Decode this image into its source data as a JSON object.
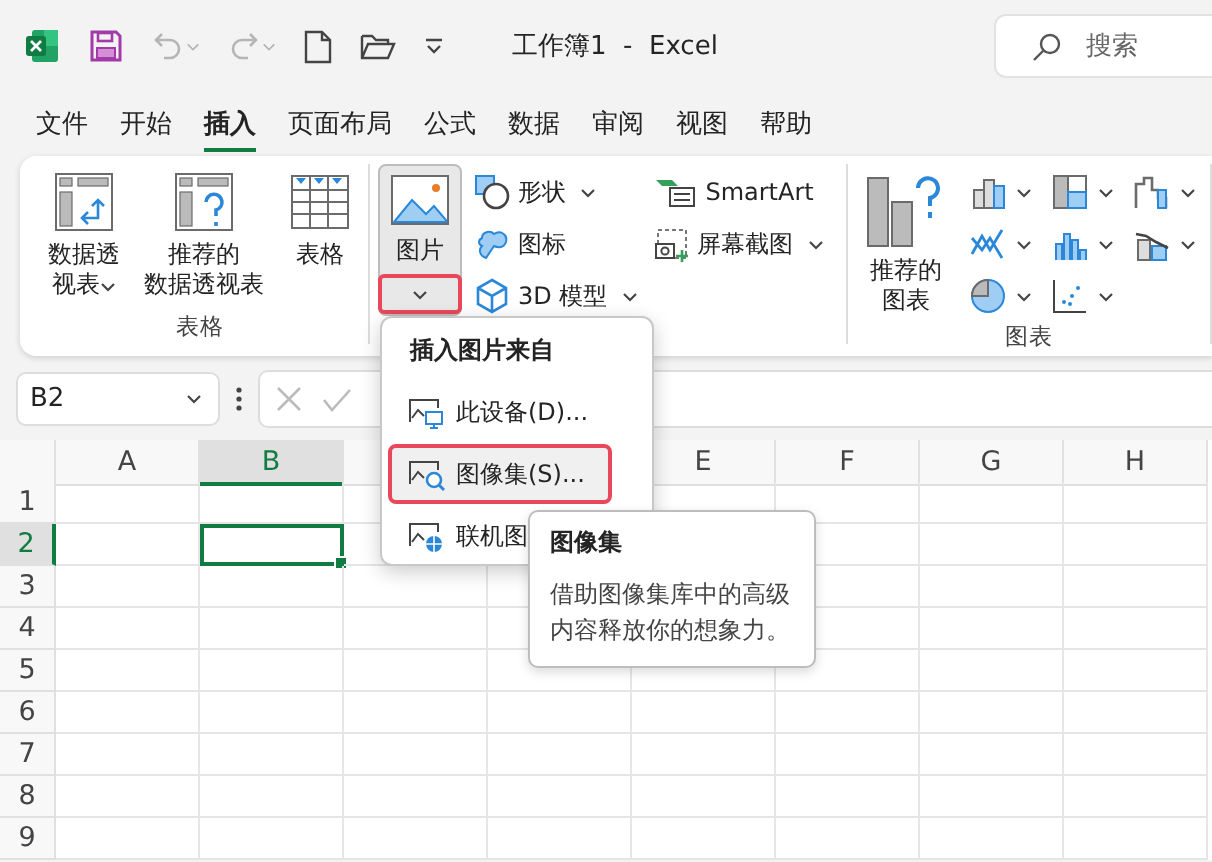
{
  "title_bar": {
    "quick_access": [
      {
        "kind": "excel"
      },
      {
        "kind": "save",
        "disabled": false
      },
      {
        "kind": "undo",
        "disabled": true
      },
      {
        "kind": "redo",
        "disabled": true
      },
      {
        "kind": "new",
        "disabled": false
      },
      {
        "kind": "open",
        "disabled": false
      },
      {
        "kind": "customize"
      }
    ],
    "title": "工作簿1  -  Excel",
    "search": {
      "placeholder": "搜索"
    }
  },
  "tabs": [
    {
      "label": "文件",
      "selected": false
    },
    {
      "label": "开始",
      "selected": false
    },
    {
      "label": "插入",
      "selected": true
    },
    {
      "label": "页面布局",
      "selected": false
    },
    {
      "label": "公式",
      "selected": false
    },
    {
      "label": "数据",
      "selected": false
    },
    {
      "label": "审阅",
      "selected": false
    },
    {
      "label": "视图",
      "selected": false
    },
    {
      "label": "帮助",
      "selected": false
    }
  ],
  "ribbon": {
    "groups": [
      {
        "label": "表格",
        "columns": [
          [
            {
              "kind": "large",
              "lines": [
                "数据透",
                "视表"
              ],
              "dropdown": true
            }
          ],
          [
            {
              "kind": "large",
              "lines": [
                "推荐的",
                "数据透视表"
              ],
              "dropdown": false
            }
          ],
          [
            {
              "kind": "large",
              "lines": [
                "表格"
              ],
              "dropdown": false
            }
          ]
        ]
      },
      {
        "columns": [
          [
            {
              "kind": "split",
              "label": "图片",
              "dropdown": true,
              "pressed": true,
              "annotated": true
            }
          ],
          [
            {
              "kind": "small",
              "label": "形状",
              "dropdown": true
            },
            {
              "kind": "small",
              "label": "图标",
              "dropdown": false
            },
            {
              "kind": "small",
              "label": "3D 模型",
              "dropdown": true
            }
          ],
          [
            {
              "kind": "small",
              "label": "SmartArt",
              "dropdown": false
            },
            {
              "kind": "small",
              "label": "屏幕截图",
              "dropdown": true
            }
          ]
        ]
      },
      {
        "label": "图表",
        "columns": [
          [
            {
              "kind": "large",
              "lines": [
                "推荐的",
                "图表"
              ],
              "dropdown": false
            }
          ],
          [
            {
              "kind": "icon",
              "dropdown": true
            },
            {
              "kind": "icon",
              "dropdown": true
            },
            {
              "kind": "icon",
              "dropdown": true
            }
          ],
          [
            {
              "kind": "icon",
              "dropdown": true
            },
            {
              "kind": "icon",
              "dropdown": true
            },
            {
              "kind": "icon",
              "dropdown": true
            }
          ],
          [
            {
              "kind": "icon",
              "dropdown": true
            },
            {
              "kind": "icon",
              "dropdown": true
            }
          ]
        ]
      }
    ]
  },
  "formula_bar": {
    "name_box": "B2"
  },
  "sheet": {
    "columns": [
      {
        "kind": "letter",
        "label": "A",
        "selected": false
      },
      {
        "kind": "letter",
        "label": "B",
        "selected": true
      },
      {
        "kind": "covered"
      },
      {
        "kind": "covered"
      },
      {
        "kind": "letter",
        "label": "E",
        "selected": false
      },
      {
        "kind": "letter",
        "label": "F",
        "selected": false
      },
      {
        "kind": "letter",
        "label": "G",
        "selected": false
      },
      {
        "kind": "letter",
        "label": "H",
        "selected": false
      }
    ],
    "rows": [
      {
        "label": "1",
        "selected": false
      },
      {
        "label": "2",
        "selected": true
      },
      {
        "label": "3",
        "selected": false
      },
      {
        "label": "4",
        "selected": false
      },
      {
        "label": "5",
        "selected": false
      },
      {
        "label": "6",
        "selected": false
      },
      {
        "label": "7",
        "selected": false
      },
      {
        "label": "8",
        "selected": false
      },
      {
        "label": "9",
        "selected": false
      }
    ]
  },
  "picture_menu": {
    "header": "插入图片来自",
    "items": [
      {
        "label": "此设备(D)...",
        "selected": false,
        "annotated": false
      },
      {
        "label": "图像集(S)...",
        "selected": true,
        "annotated": true
      },
      {
        "label": "联机图",
        "selected": false,
        "annotated": false
      }
    ]
  },
  "tooltip": {
    "title": "图像集",
    "body": "借助图像集库中的高级内容释放你的想象力。"
  }
}
